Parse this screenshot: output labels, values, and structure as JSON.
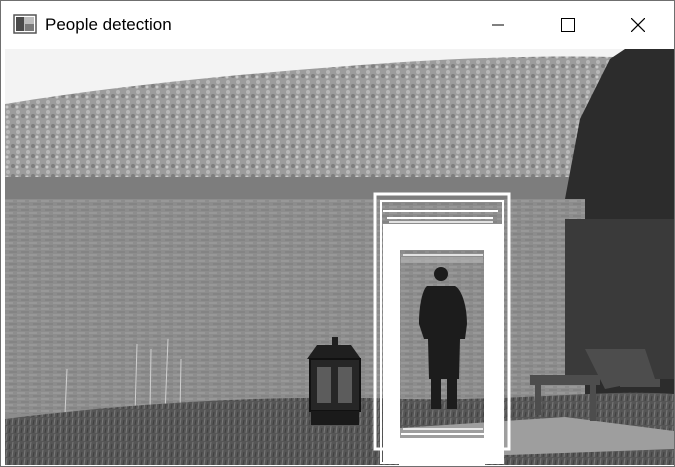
{
  "window": {
    "title": "People detection",
    "icons": {
      "app": "image-window-icon",
      "minimize": "minimize-icon",
      "maximize": "maximize-icon",
      "close": "close-icon"
    }
  },
  "image": {
    "content": "grayscale-lake-with-person-detection",
    "colors": {
      "sky": "#f2f2f2",
      "forest": "#9a9a9a",
      "dark_trees": "#2e2e2e",
      "water": "#8e8e8e",
      "ground": "#5a5a5a",
      "detection_box": "#ffffff"
    },
    "detections_drawn": 4
  }
}
